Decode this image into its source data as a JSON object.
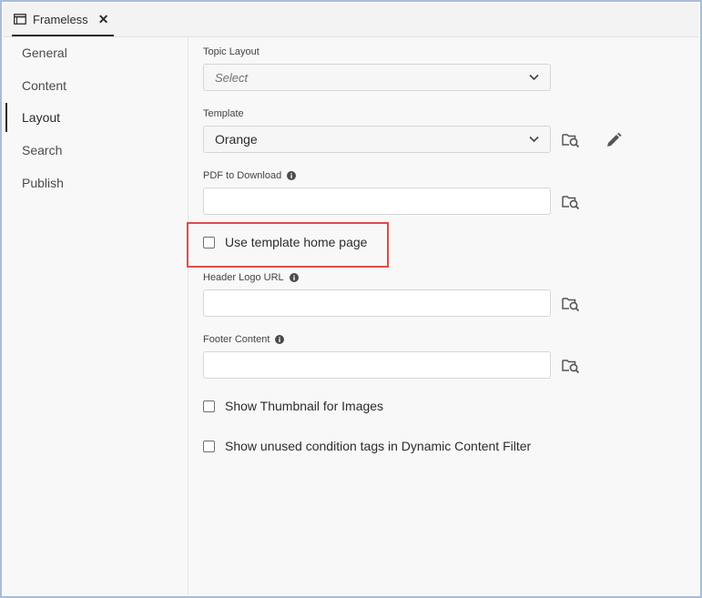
{
  "tab": {
    "title": "Frameless",
    "close_label": "✕",
    "icon": "window-icon"
  },
  "sidebar": {
    "items": [
      {
        "label": "General",
        "active": false
      },
      {
        "label": "Content",
        "active": false
      },
      {
        "label": "Layout",
        "active": true
      },
      {
        "label": "Search",
        "active": false
      },
      {
        "label": "Publish",
        "active": false
      }
    ]
  },
  "form": {
    "topic_layout": {
      "label": "Topic Layout",
      "placeholder": "Select"
    },
    "template": {
      "label": "Template",
      "value": "Orange"
    },
    "pdf_download": {
      "label": "PDF to Download",
      "value": ""
    },
    "use_template_home": {
      "label": "Use template home page",
      "checked": false
    },
    "header_logo": {
      "label": "Header Logo URL",
      "value": ""
    },
    "footer_content": {
      "label": "Footer Content",
      "value": ""
    },
    "show_thumbnail": {
      "label": "Show Thumbnail for Images",
      "checked": false
    },
    "show_unused_tags": {
      "label": "Show unused condition tags in Dynamic Content Filter",
      "checked": false
    }
  },
  "colors": {
    "highlight": "#e14b4b",
    "frame_border": "#a9bcd9"
  }
}
